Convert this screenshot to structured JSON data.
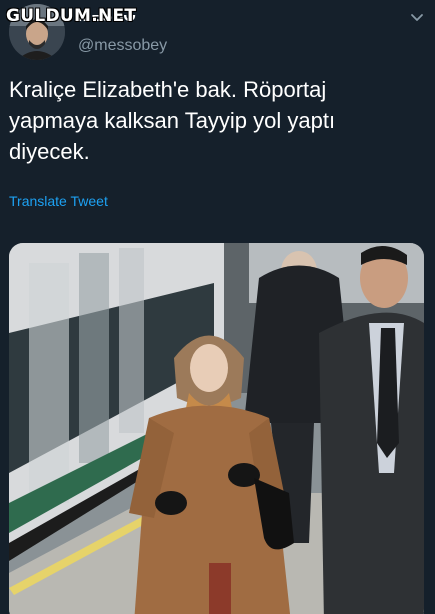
{
  "watermark": "GULDUM.NET",
  "user": {
    "display_name": "MESSO",
    "handle": "@messobey",
    "avatar_icon": "user-avatar"
  },
  "menu_icon": "chevron-down-icon",
  "tweet": {
    "lines": [
      "Kraliçe Elizabeth'e bak. Röportaj",
      "yapmaya kalksan Tayyip yol yaptı",
      "diyecek."
    ]
  },
  "translate_label": "Translate Tweet",
  "colors": {
    "background": "#15202b",
    "link": "#1da1f2",
    "secondary_text": "#8899a6"
  }
}
